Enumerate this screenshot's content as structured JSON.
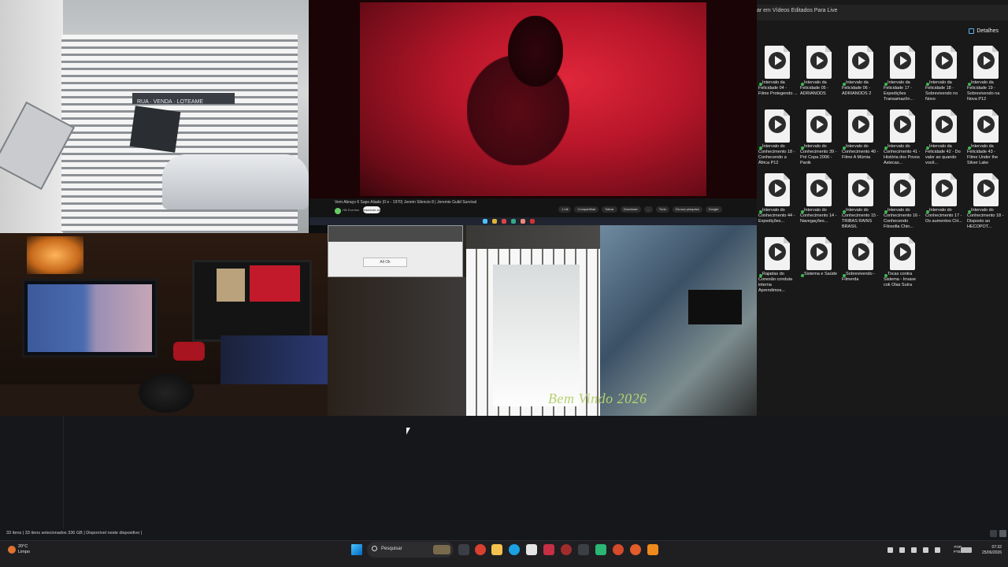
{
  "cam_gate": {
    "sign_text": "RUA · VENDA · LOTEAME"
  },
  "video": {
    "title": "Vem Abraço 6 Sapo Aliado (0 e - 1970) Jereim Silencio 8 | Jeremie Guild Survival",
    "channel": "HB Eventos",
    "subscribe": "Inscrever-se",
    "actions": [
      "1 mil",
      "Compartilhar",
      "Salvar",
      "Download",
      "...",
      "Tudo",
      "Da sua pesquisa",
      "Google"
    ]
  },
  "cam_graffiti": {
    "dialog_ok": "All Ok",
    "overlay_text": "Bem Vindo 2026"
  },
  "explorer": {
    "address": "ar em Vídeos Editados Para Live",
    "details_label": "Detalhes",
    "files": [
      {
        "name": "Intervalo da Felicidade 04 - Filme Protegendo ..."
      },
      {
        "name": "Intervalo da Felicidade 05 - ADRIANODS"
      },
      {
        "name": "Intervalo da Felicidade 06 - ADRIANODS 2"
      },
      {
        "name": "Intervalo da Felicidade 17 - Expedições Transamazôn..."
      },
      {
        "name": "Intervalo da Felicidade 18 - Sobrevivendo no Novo"
      },
      {
        "name": "Intervalo da Felicidade 19 - Sobrevivendo na Nova P12"
      },
      {
        "name": "Intervalo do Conhecimento 18 - Conhecendo a África P12"
      },
      {
        "name": "Intervalo do Conhecimento 39 - Pré Copa 2006 - Panik"
      },
      {
        "name": "Intervalo do Conhecimento 40 - Filme A Múmia"
      },
      {
        "name": "Intervalo do Conhecimento 41 - História dos Povos Astecas..."
      },
      {
        "name": "Intervalo da Felicidade 42 - Do valor ao quando você..."
      },
      {
        "name": "Intervalo da Felicidade 43 - Filme Under the Silver Lake"
      },
      {
        "name": "Intervalo do Conhecimento 44 - Expedições..."
      },
      {
        "name": "Intervalo do Conhecimento 14 - Navegações..."
      },
      {
        "name": "Intervalo do Conhecimento 15 - TRIBAS RAINS BRASIL"
      },
      {
        "name": "Intervalo do Conhecimento 16 - Conhecendo Filosofia Chin..."
      },
      {
        "name": "Intervalo do Conhecimento 17 - Os aumentos CH..."
      },
      {
        "name": "Intervalo do Conhecimento 18 - Disposto ao HECOPOT..."
      },
      {
        "name": "Rajadas do Conexão conduta interna Aprendimos..."
      },
      {
        "name": "Sistema e Saúde"
      },
      {
        "name": "Sobrevivendo - Filmerda"
      },
      {
        "name": "Tocas contra Sistema - Invase cok Olas Suíra"
      }
    ]
  },
  "statusbar": {
    "text": "33 itens  |  33 itens selecionados 336 GB  |  Disponível neste dispositivo  |"
  },
  "taskbar": {
    "weather_temp": "20°C",
    "weather_cond": "Limpo",
    "search_placeholder": "Pesquisar",
    "lang_top": "POR",
    "lang_bottom": "PTB2",
    "time": "07:32",
    "date": "25/06/2026"
  },
  "colors": {
    "accent": "#4cc2ff",
    "file_synced_dot": "#3fb950",
    "overlay_green": "#b6d26f"
  },
  "icons": [
    "weather-icon",
    "windows-start-icon",
    "search-icon",
    "task-view-icon",
    "file-explorer-icon",
    "edge-icon",
    "chrome-icon",
    "store-icon",
    "vlc-icon"
  ]
}
